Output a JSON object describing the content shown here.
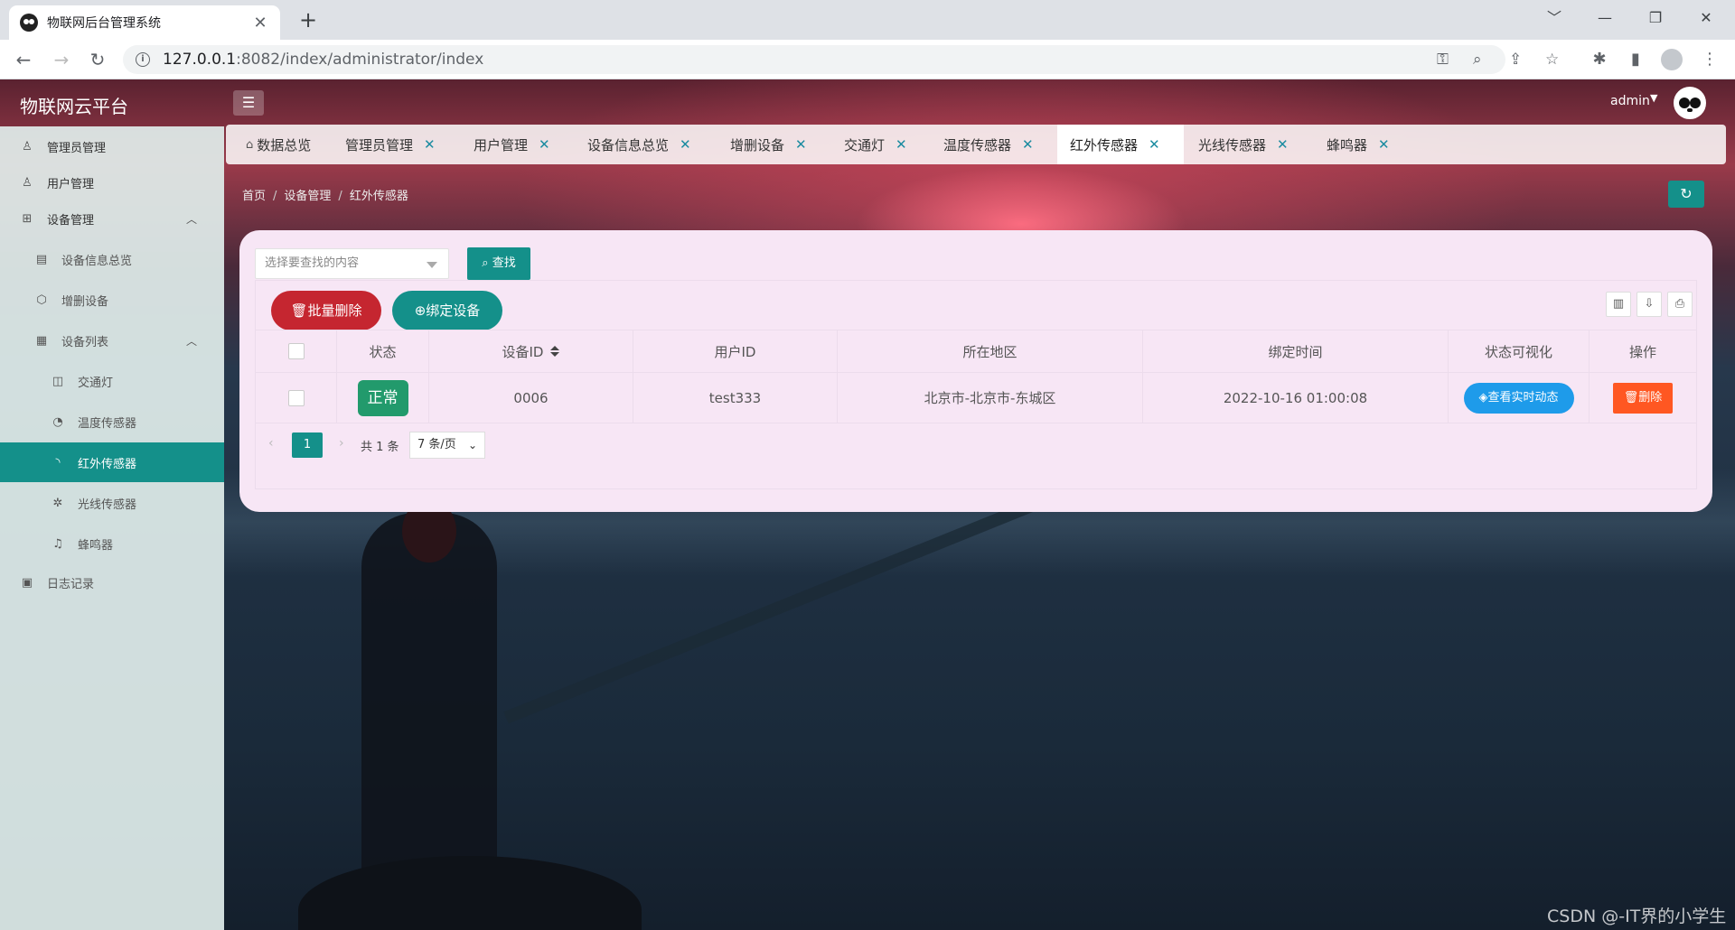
{
  "browser": {
    "tab_title": "物联网后台管理系统",
    "tab_close": "✕",
    "new_tab": "+",
    "url_host": "127.0.0.1",
    "url_path": ":8082/index/administrator/index",
    "win_min": "﹀",
    "win_minimize": "—",
    "win_restore": "❐",
    "win_close": "✕"
  },
  "header": {
    "logo": "物联网云平台",
    "user": "admin"
  },
  "sidebar": {
    "items": [
      {
        "label": "管理员管理",
        "icon": "user-icon"
      },
      {
        "label": "用户管理",
        "icon": "user-icon"
      },
      {
        "label": "设备管理",
        "icon": "apps-icon"
      },
      {
        "label": "设备信息总览",
        "icon": "list-icon"
      },
      {
        "label": "增删设备",
        "icon": "cube-icon"
      },
      {
        "label": "设备列表",
        "icon": "grid-icon"
      },
      {
        "label": "交通灯",
        "icon": "traffic-icon"
      },
      {
        "label": "温度传感器",
        "icon": "temperature-icon"
      },
      {
        "label": "红外传感器",
        "icon": "rss-icon"
      },
      {
        "label": "光线传感器",
        "icon": "light-icon"
      },
      {
        "label": "蜂鸣器",
        "icon": "bell-icon"
      },
      {
        "label": "日志记录",
        "icon": "log-icon"
      }
    ],
    "active_index": 8
  },
  "tabs": [
    {
      "label": "数据总览"
    },
    {
      "label": "管理员管理"
    },
    {
      "label": "用户管理"
    },
    {
      "label": "设备信息总览"
    },
    {
      "label": "增删设备"
    },
    {
      "label": "交通灯"
    },
    {
      "label": "温度传感器"
    },
    {
      "label": "红外传感器"
    },
    {
      "label": "光线传感器"
    },
    {
      "label": "蜂鸣器"
    }
  ],
  "breadcrumb": [
    "首页",
    "设备管理",
    "红外传感器"
  ],
  "breadcrumb_sep": "/",
  "search": {
    "placeholder": "选择要查找的内容",
    "button": "查找"
  },
  "actions": {
    "batch_delete": "批量删除",
    "bind_device": "绑定设备"
  },
  "table": {
    "columns": [
      "状态",
      "设备ID",
      "用户ID",
      "所在地区",
      "绑定时间",
      "状态可视化",
      "操作"
    ],
    "rows": [
      {
        "status": "正常",
        "device_id": "0006",
        "user_id": "test333",
        "region": "北京市-北京市-东城区",
        "bind_time": "2022-10-16 01:00:08",
        "view_btn": "查看实时动态",
        "delete_btn": "删除"
      }
    ]
  },
  "pagination": {
    "current": "1",
    "total": "共 1 条",
    "page_size": "7 条/页"
  },
  "watermark": "CSDN @-IT界的小学生",
  "colors": {
    "primary": "#14908a",
    "danger": "#c52630",
    "blue": "#1e9bea",
    "orange": "#ff5722",
    "card": "#f7e6f5"
  }
}
